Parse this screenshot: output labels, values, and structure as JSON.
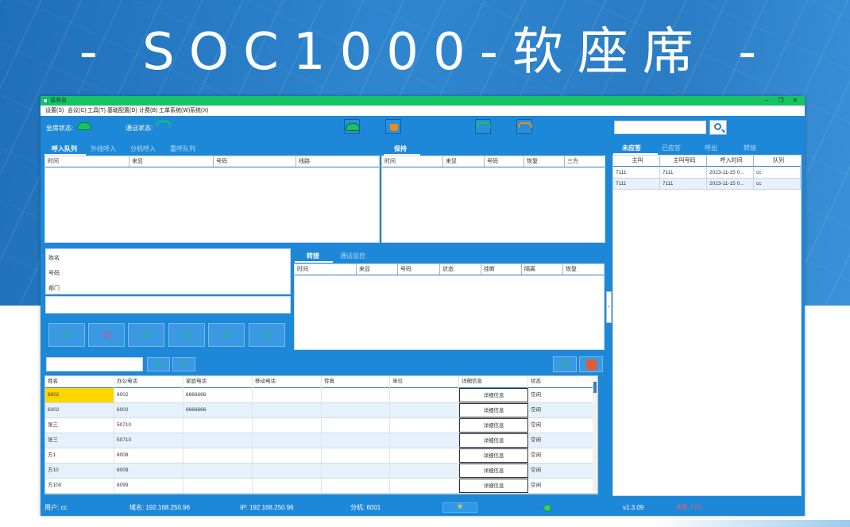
{
  "banner": "- SOC1000-软座席 -",
  "window": {
    "title": "话务台",
    "min": "–",
    "restore": "❐",
    "close": "✕"
  },
  "menu": [
    "设置(S)",
    "会议(C)",
    "工具(T)",
    "基础配置(D)",
    "计费(B)",
    "工单系统(W)",
    "系统(X)"
  ],
  "status": {
    "seat_label": "坐席状态:",
    "call_label": "通话状态:"
  },
  "search": {
    "value": "",
    "placeholder": ""
  },
  "tabs_left": [
    "呼入队列",
    "外线呼入",
    "分机呼入",
    "重呼队列"
  ],
  "tab_hold": "保持",
  "tabs_right": [
    "未应答",
    "已应答",
    "呼出",
    "转接"
  ],
  "queue_cols": [
    "时间",
    "来显",
    "号码",
    "线路"
  ],
  "hold_cols": [
    "时间",
    "来显",
    "号码",
    "恢复",
    "三方"
  ],
  "info_fields": [
    "姓名",
    "号码",
    "部门"
  ],
  "tabs_transfer": [
    "转接",
    "通话监控"
  ],
  "transfer_cols": [
    "时间",
    "来显",
    "号码",
    "状态",
    "挂断",
    "隔离",
    "恢复"
  ],
  "dir_cols": [
    "姓名",
    "办公电话",
    "家庭电话",
    "移动电话",
    "传真",
    "单位",
    "详细信息",
    "状态"
  ],
  "dir_rows": [
    {
      "name": "6002",
      "office": "6002",
      "home": "6666666",
      "detail": "详细信息",
      "state": "空闲"
    },
    {
      "name": "6002",
      "office": "6002",
      "home": "6666666",
      "detail": "详细信息",
      "state": "空闲"
    },
    {
      "name": "张三",
      "office": "50710",
      "home": "",
      "detail": "详细信息",
      "state": "空闲"
    },
    {
      "name": "张三",
      "office": "50710",
      "home": "",
      "detail": "详细信息",
      "state": "空闲"
    },
    {
      "name": "方1",
      "office": "8008",
      "home": "",
      "detail": "详细信息",
      "state": "空闲"
    },
    {
      "name": "方10",
      "office": "8009",
      "home": "",
      "detail": "详细信息",
      "state": "空闲"
    },
    {
      "name": "方100",
      "office": "8099",
      "home": "",
      "detail": "详细信息",
      "state": "空闲"
    }
  ],
  "missed_cols": [
    "主叫",
    "主叫号码",
    "呼入时间",
    "队列"
  ],
  "missed_rows": [
    {
      "caller": "7111",
      "number": "7111",
      "time": "2023-11-15 0...",
      "queue": "cc"
    },
    {
      "caller": "7111",
      "number": "7111",
      "time": "2023-11-15 0...",
      "queue": "cc"
    }
  ],
  "statusbar": {
    "user": "用户: cc",
    "domain": "域名: 192.168.250.96",
    "ip": "IP: 192.168.250.96",
    "ext": "分机: 6001",
    "version": "v1.3.09",
    "alert": "未接: 2 (0)"
  },
  "colors": {
    "accent": "#1e88d8",
    "title_green": "#16c464",
    "highlight": "#ffd700"
  }
}
